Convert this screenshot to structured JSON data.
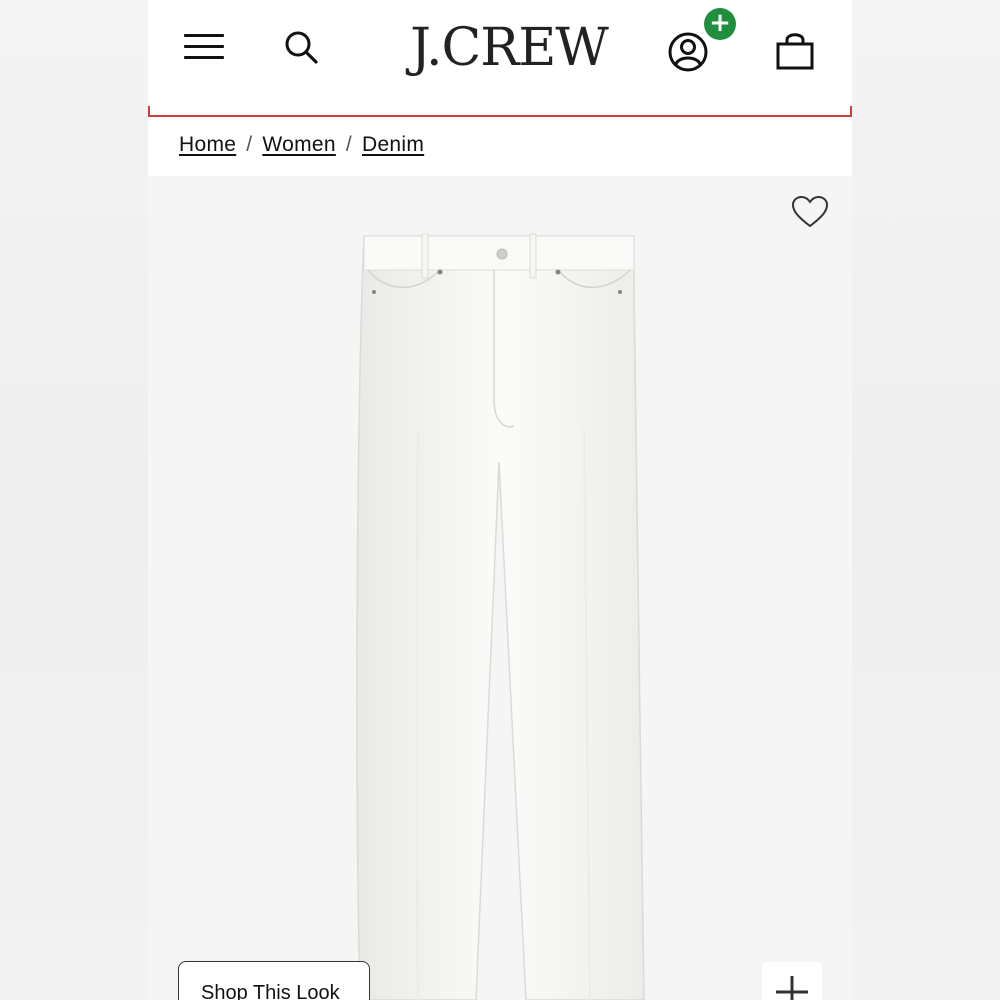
{
  "header": {
    "logo": "J.CREW",
    "menu_icon": "hamburger-menu-icon",
    "search_icon": "search-icon",
    "account_icon": "account-icon",
    "account_badge": "+",
    "bag_icon": "shopping-bag-icon"
  },
  "breadcrumb": {
    "items": [
      {
        "label": "Home"
      },
      {
        "label": "Women"
      },
      {
        "label": "Denim"
      }
    ],
    "separator": "/"
  },
  "product": {
    "image_subject": "white straight-leg jeans",
    "wishlist_icon": "heart-icon",
    "shop_look_label": "Shop This Look",
    "zoom_icon": "plus-icon"
  },
  "colors": {
    "header_accent": "#c8413b",
    "badge_green": "#1f8f3e",
    "text": "#111111",
    "image_background": "#f5f5f5"
  }
}
